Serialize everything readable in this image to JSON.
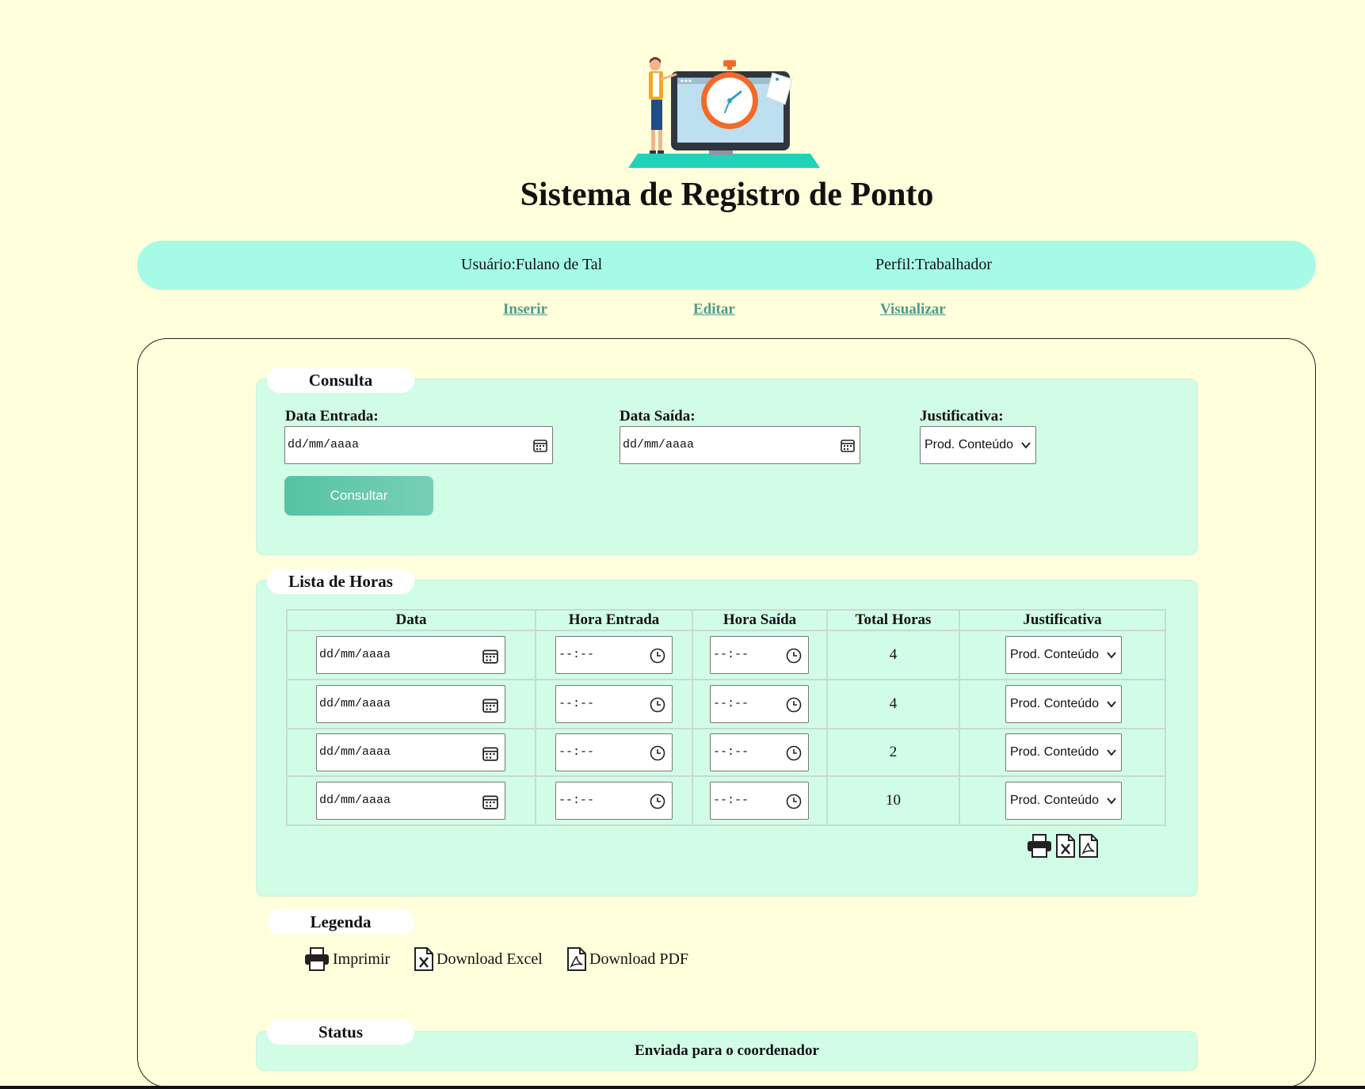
{
  "header": {
    "title": "Sistema de Registro de Ponto"
  },
  "user_bar": {
    "user": "Usuário:Fulano de Tal",
    "profile": "Perfil:Trabalhador"
  },
  "nav": {
    "insert": "Inserir",
    "edit": "Editar",
    "view": "Visualizar"
  },
  "consulta": {
    "legend": "Consulta",
    "entry_label": "Data Entrada:",
    "entry_placeholder": "dd/mm/aaaa",
    "exit_label": "Data Saída:",
    "exit_placeholder": "dd/mm/aaaa",
    "justification_label": "Justificativa:",
    "justification_value": "Prod. Conteúdo",
    "button": "Consultar"
  },
  "hours": {
    "legend": "Lista de Horas",
    "columns": [
      "Data",
      "Hora Entrada",
      "Hora Saída",
      "Total Horas",
      "Justificativa"
    ],
    "rows": [
      {
        "date": "dd/mm/aaaa",
        "entry": "--:--",
        "exit": "--:--",
        "total": "4",
        "justification": "Prod. Conteúdo"
      },
      {
        "date": "dd/mm/aaaa",
        "entry": "--:--",
        "exit": "--:--",
        "total": "4",
        "justification": "Prod. Conteúdo"
      },
      {
        "date": "dd/mm/aaaa",
        "entry": "--:--",
        "exit": "--:--",
        "total": "2",
        "justification": "Prod. Conteúdo"
      },
      {
        "date": "dd/mm/aaaa",
        "entry": "--:--",
        "exit": "--:--",
        "total": "10",
        "justification": "Prod. Conteúdo"
      }
    ],
    "export_icons": [
      "printer-icon",
      "excel-icon",
      "pdf-icon"
    ]
  },
  "legenda": {
    "legend": "Legenda",
    "items": [
      {
        "icon": "printer-icon",
        "label": "Imprimir"
      },
      {
        "icon": "excel-icon",
        "label": "Download Excel"
      },
      {
        "icon": "pdf-icon",
        "label": "Download PDF"
      }
    ]
  },
  "status": {
    "legend": "Status",
    "text": "Enviada para o coordenador"
  },
  "colors": {
    "background": "#ffffdb",
    "user_bar": "#a6fbe6",
    "section": "#d1fde6",
    "button": "#5cc5a6",
    "link": "#4f9a8a"
  }
}
